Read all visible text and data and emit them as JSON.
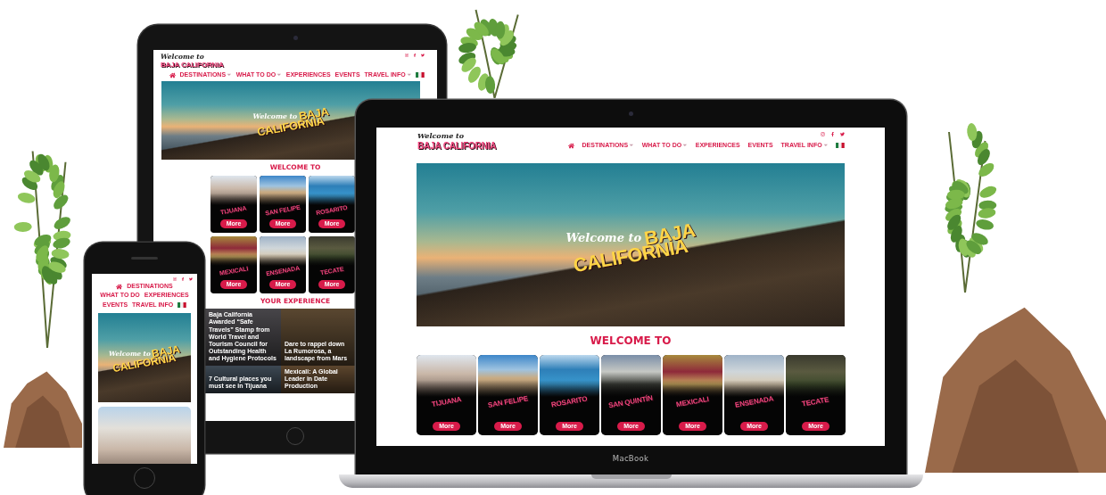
{
  "tablet": {
    "logo": {
      "script": "Welcome to",
      "wordmark": "BAJA CALIFORNIA"
    },
    "nav": [
      {
        "label": "DESTINATIONS",
        "dropdown": true
      },
      {
        "label": "WHAT TO DO",
        "dropdown": true
      },
      {
        "label": "EXPERIENCES",
        "dropdown": false
      },
      {
        "label": "EVENTS",
        "dropdown": false
      },
      {
        "label": "TRAVEL INFO",
        "dropdown": true
      }
    ],
    "hero": {
      "script": "Welcome to",
      "line1": "BAJA",
      "line2": "CALIFORNIA"
    },
    "welcome_title": "WELCOME TO",
    "card_rows": [
      [
        {
          "name": "TIJUANA",
          "button": "More"
        },
        {
          "name": "SAN FELIPE",
          "button": "More"
        },
        {
          "name": "ROSARITO",
          "button": "More"
        }
      ],
      [
        {
          "name": "MEXICALI",
          "button": "More"
        },
        {
          "name": "ENSENADA",
          "button": "More"
        },
        {
          "name": "TECATE",
          "button": "More"
        }
      ]
    ],
    "experience_title": "YOUR EXPERIENCE",
    "articles": [
      {
        "title": "Baja California Awarded “Safe Travels” Stamp from World Travel and Tourism Council for Outstanding Health and Hygiene Protocols"
      },
      {
        "title": "Dare to rappel down La Rumorosa, a landscape from Mars"
      },
      {
        "title": "7 Cultural places you must see in Tijuana"
      },
      {
        "title": "Mexicali: A Global Leader in Date Production"
      }
    ]
  },
  "laptop": {
    "logo": {
      "script": "Welcome to",
      "wordmark": "BAJA CALIFORNIA"
    },
    "nav": [
      {
        "label": "DESTINATIONS",
        "dropdown": true
      },
      {
        "label": "WHAT TO DO",
        "dropdown": true
      },
      {
        "label": "EXPERIENCES",
        "dropdown": false
      },
      {
        "label": "EVENTS",
        "dropdown": false
      },
      {
        "label": "TRAVEL INFO",
        "dropdown": true
      }
    ],
    "hero": {
      "script": "Welcome to",
      "line1": "BAJA",
      "line2": "CALIFORNIA"
    },
    "welcome_title": "WELCOME TO",
    "cards": [
      {
        "name": "TIJUANA",
        "button": "More"
      },
      {
        "name": "SAN FELIPE",
        "button": "More"
      },
      {
        "name": "ROSARITO",
        "button": "More"
      },
      {
        "name": "SAN QUINTÍN",
        "button": "More"
      },
      {
        "name": "MEXICALI",
        "button": "More"
      },
      {
        "name": "ENSENADA",
        "button": "More"
      },
      {
        "name": "TECATE",
        "button": "More"
      }
    ],
    "brand": "MacBook"
  },
  "phone": {
    "nav": [
      {
        "label": "DESTINATIONS",
        "dropdown": false
      },
      {
        "label": "WHAT TO DO",
        "dropdown": false
      },
      {
        "label": "EXPERIENCES",
        "dropdown": false
      },
      {
        "label": "EVENTS",
        "dropdown": false
      },
      {
        "label": "TRAVEL INFO",
        "dropdown": false
      }
    ],
    "hero": {
      "script": "Welcome to",
      "line1": "BAJA",
      "line2": "CALIFORNIA"
    }
  }
}
